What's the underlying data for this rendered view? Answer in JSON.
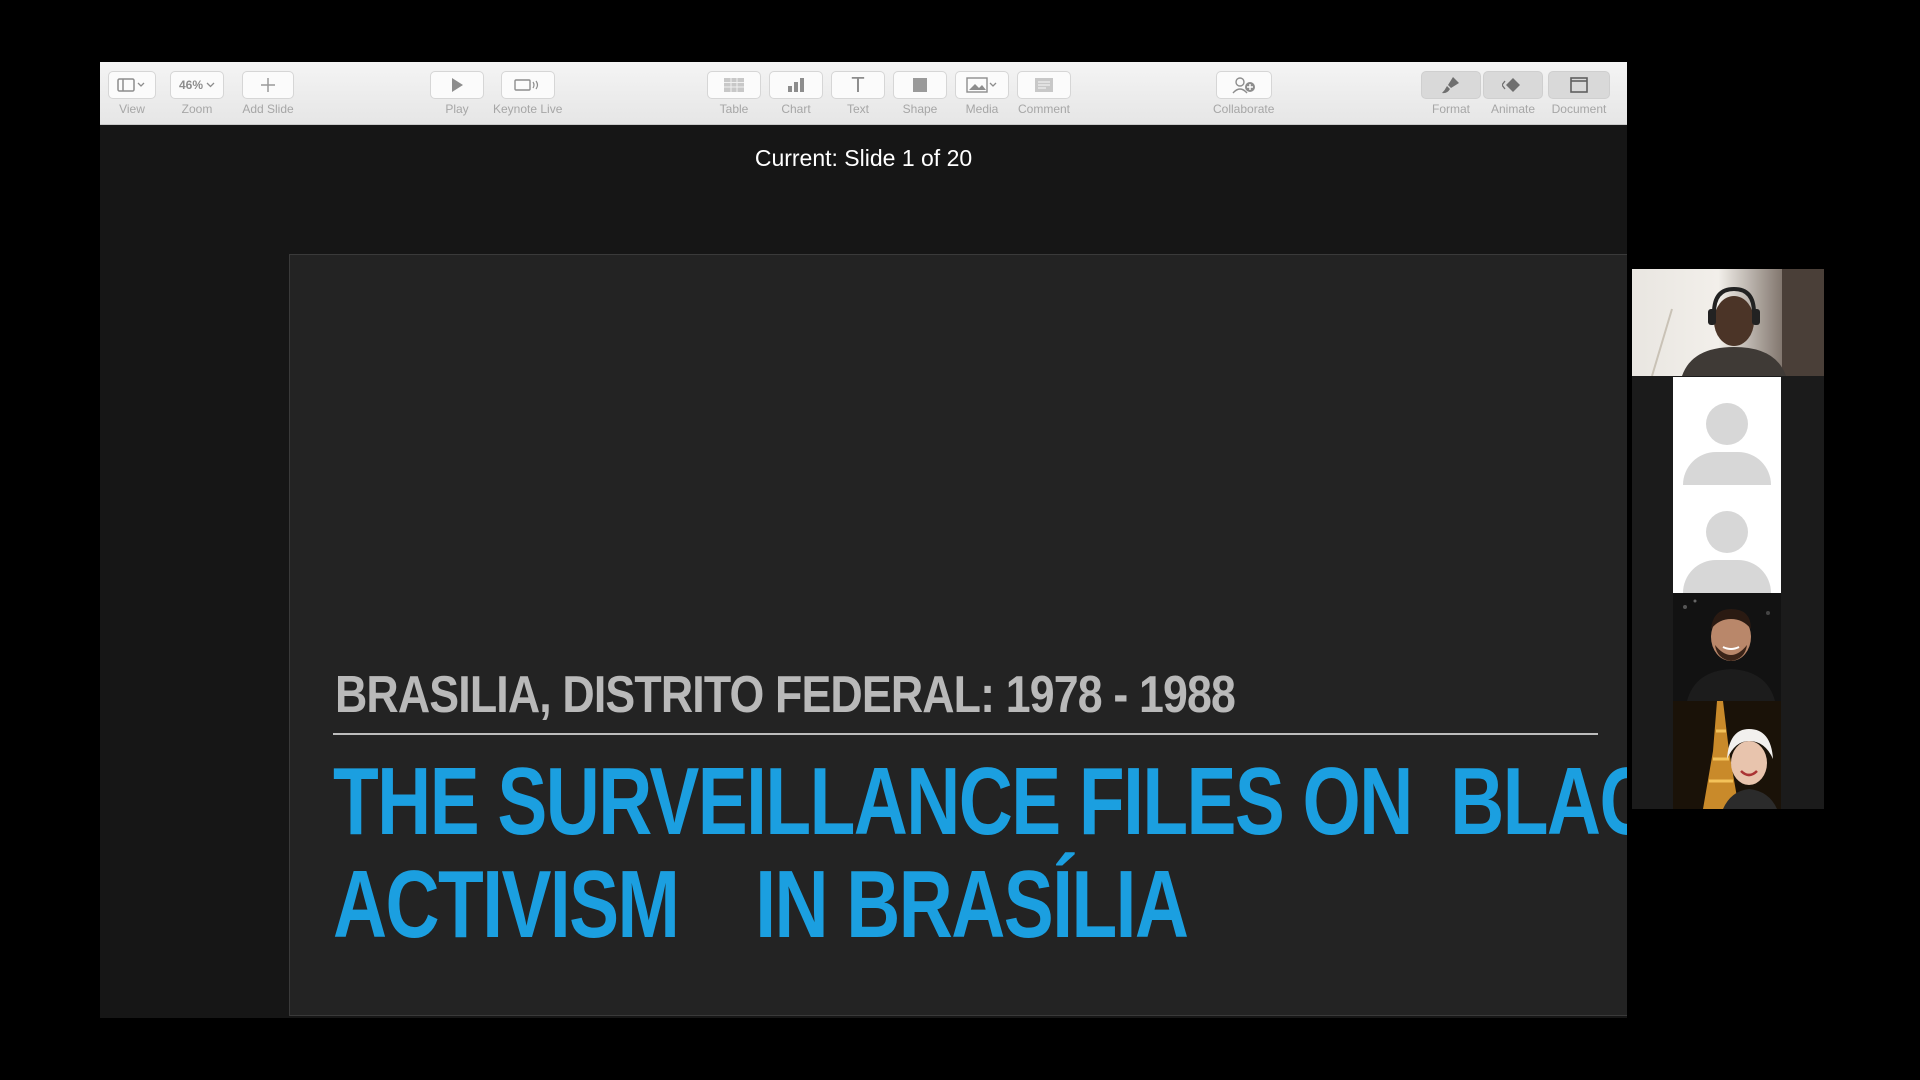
{
  "toolbar": {
    "view": {
      "label": "View",
      "icon": "sidebar-view-icon"
    },
    "zoom": {
      "label": "Zoom",
      "value": "46%"
    },
    "add_slide": {
      "label": "Add Slide",
      "icon": "plus-icon"
    },
    "play": {
      "label": "Play",
      "icon": "play-icon"
    },
    "keynote_live": {
      "label": "Keynote Live",
      "icon": "keynote-live-icon"
    },
    "table": {
      "label": "Table",
      "icon": "table-icon"
    },
    "chart": {
      "label": "Chart",
      "icon": "chart-icon"
    },
    "text": {
      "label": "Text",
      "icon": "text-icon",
      "glyph": "T"
    },
    "shape": {
      "label": "Shape",
      "icon": "shape-icon"
    },
    "media": {
      "label": "Media",
      "icon": "media-icon"
    },
    "comment": {
      "label": "Comment",
      "icon": "comment-icon"
    },
    "collaborate": {
      "label": "Collaborate",
      "icon": "collaborate-icon"
    },
    "format": {
      "label": "Format",
      "icon": "format-brush-icon"
    },
    "animate": {
      "label": "Animate",
      "icon": "animate-icon"
    },
    "document": {
      "label": "Document",
      "icon": "document-icon"
    }
  },
  "status": {
    "current_slide": "Current: Slide 1 of 20"
  },
  "slide": {
    "subtitle": "BRASILIA, DISTRITO FEDERAL: 1978 - 1988",
    "title": "THE SURVEILLANCE FILES ON  BLACK\nACTIVISM    IN BRASÍLIA"
  },
  "participants": [
    {
      "type": "video",
      "name": "host-video"
    },
    {
      "type": "avatar",
      "name": "participant-avatar"
    },
    {
      "type": "avatar",
      "name": "participant-avatar"
    },
    {
      "type": "video",
      "name": "participant-video"
    },
    {
      "type": "video",
      "name": "participant-video"
    }
  ],
  "colors": {
    "title": "#1b9fe0",
    "subtitle": "#b9b9b9",
    "slide_bg": "#232323"
  }
}
